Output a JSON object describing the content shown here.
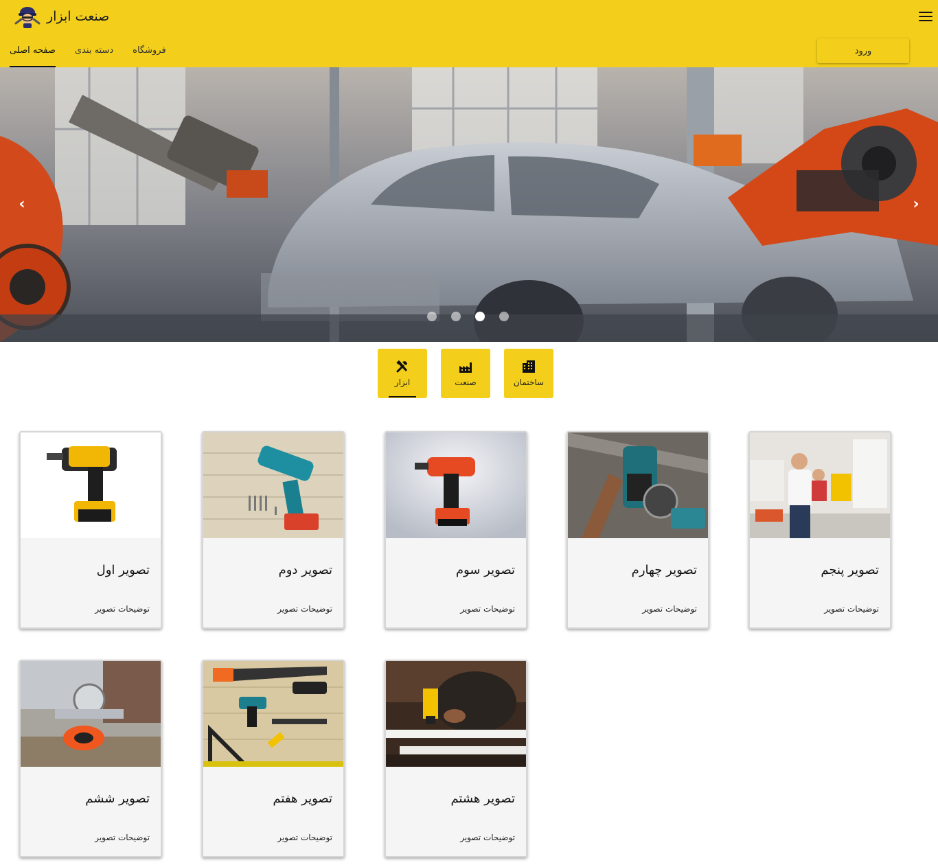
{
  "brand": {
    "name": "صنعت ابزار",
    "logo_icon": "worker-helmet-icon"
  },
  "header": {
    "menu_icon": "hamburger-menu-icon",
    "nav": [
      {
        "label": "صفحه اصلی",
        "active": true
      },
      {
        "label": "دسته بندی",
        "active": false
      },
      {
        "label": "فروشگاه",
        "active": false
      }
    ],
    "login_label": "ورود"
  },
  "carousel": {
    "prev_icon": "chevron-left-icon",
    "next_icon": "chevron-right-icon",
    "slide_count": 4,
    "active_slide": 3
  },
  "categories": [
    {
      "label": "ساختمان",
      "icon": "building-icon",
      "active": false
    },
    {
      "label": "صنعت",
      "icon": "factory-icon",
      "active": false
    },
    {
      "label": "ابزار",
      "icon": "tools-icon",
      "active": true
    }
  ],
  "cards": [
    {
      "title": "تصویر اول",
      "description": "توضیحات تصویر"
    },
    {
      "title": "تصویر دوم",
      "description": "توضیحات تصویر"
    },
    {
      "title": "تصویر سوم",
      "description": "توضیحات تصویر"
    },
    {
      "title": "تصویر چهارم",
      "description": "توضیحات تصویر"
    },
    {
      "title": "تصویر پنجم",
      "description": "توضیحات تصویر"
    },
    {
      "title": "تصویر ششم",
      "description": "توضیحات تصویر"
    },
    {
      "title": "تصویر هفتم",
      "description": "توضیحات تصویر"
    },
    {
      "title": "تصویر هشتم",
      "description": "توضیحات تصویر"
    }
  ],
  "colors": {
    "accent": "#f3cf1b",
    "card_bg": "#f5f5f5",
    "text": "#111111"
  }
}
